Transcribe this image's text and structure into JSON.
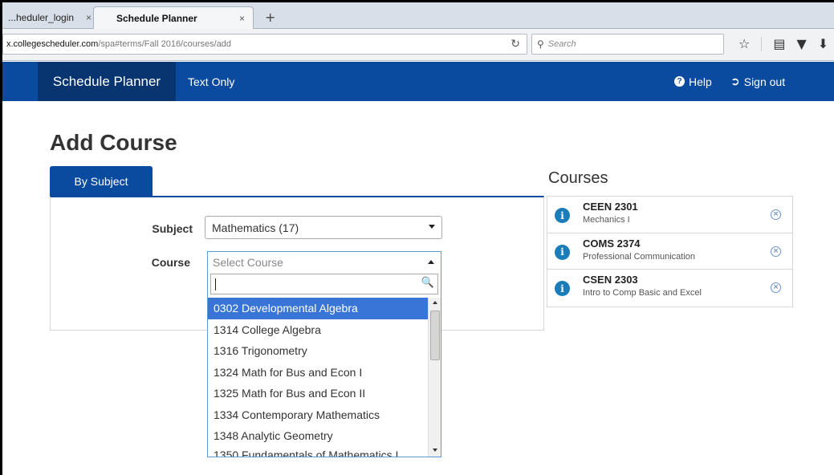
{
  "browser": {
    "tabs": [
      {
        "label": "...heduler_login",
        "close": "×"
      },
      {
        "label": "Schedule Planner",
        "close": "×"
      }
    ],
    "new_tab": "+",
    "url_domain": "x.collegescheduler.com",
    "url_path": "/spa#terms/Fall 2016/courses/add",
    "search_placeholder": "Search"
  },
  "app": {
    "brand": "Schedule Planner",
    "nav_text_only": "Text Only",
    "help": "Help",
    "sign_out": "Sign out"
  },
  "page": {
    "title": "Add Course",
    "tab_by_subject": "By Subject",
    "subject_label": "Subject",
    "subject_value": "Mathematics (17)",
    "course_label": "Course",
    "course_placeholder": "Select Course"
  },
  "dropdown": {
    "search_value": "",
    "items": [
      "0302 Developmental Algebra",
      "1314 College Algebra",
      "1316 Trigonometry",
      "1324 Math for Bus and Econ I",
      "1325 Math for Bus and Econ II",
      "1334 Contemporary Mathematics",
      "1348 Analytic Geometry",
      "1350 Fundamentals of Mathematics I"
    ]
  },
  "courses": {
    "title": "Courses",
    "items": [
      {
        "code": "CEEN 2301",
        "name": "Mechanics I"
      },
      {
        "code": "COMS 2374",
        "name": "Professional Communication"
      },
      {
        "code": "CSEN 2303",
        "name": "Intro to Comp Basic and Excel"
      }
    ]
  },
  "colors": {
    "brand_blue": "#0b4b9f",
    "brand_dark": "#08346f",
    "highlight": "#3875d7",
    "info_icon": "#1a7cb8"
  }
}
